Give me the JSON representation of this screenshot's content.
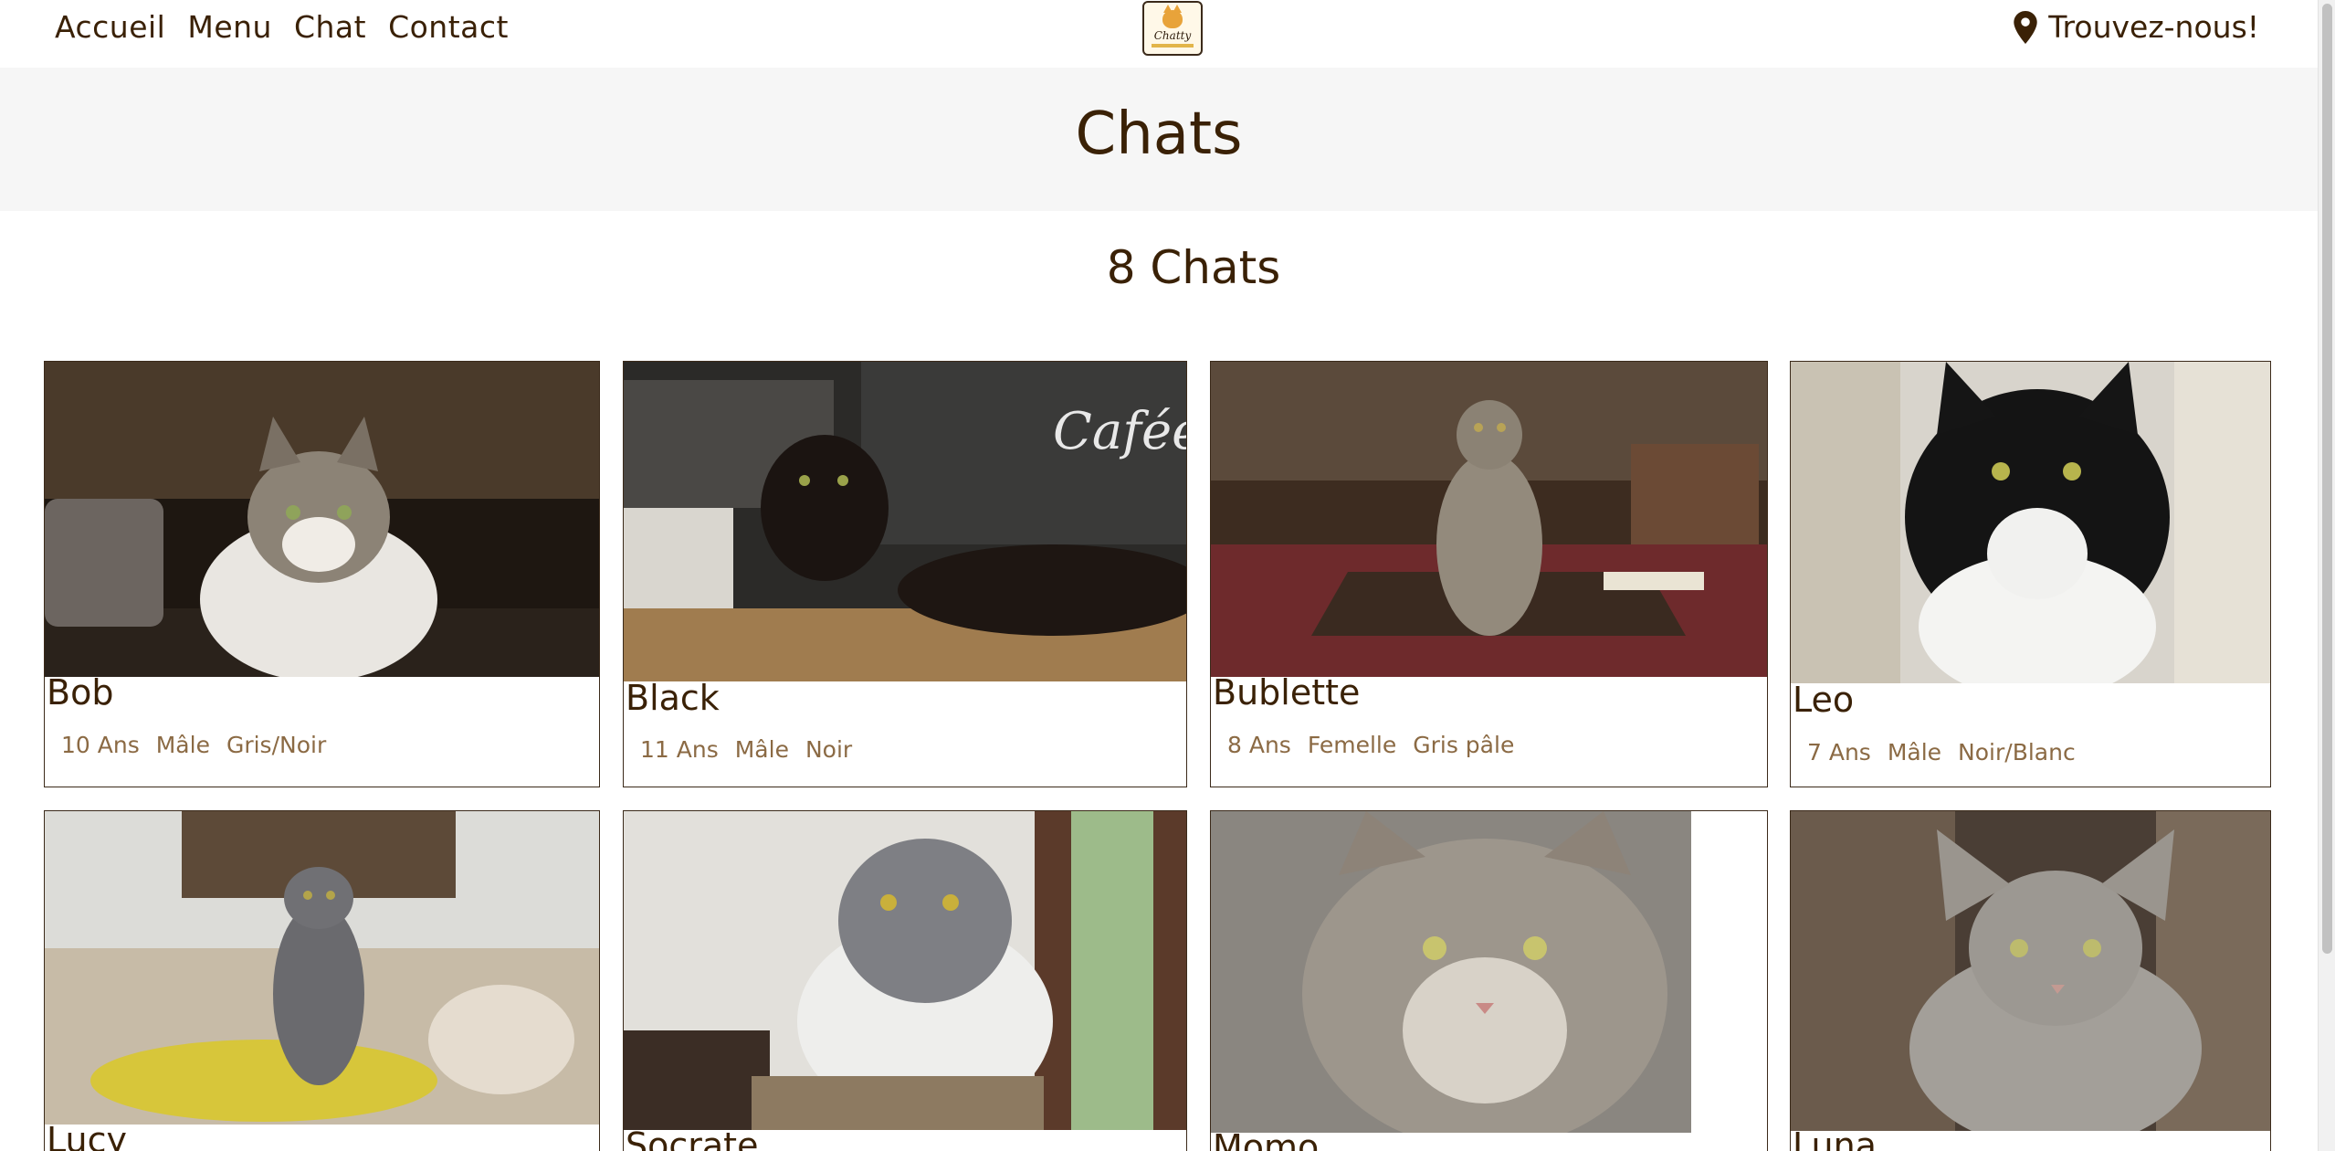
{
  "nav": {
    "items": [
      "Accueil",
      "Menu",
      "Chat",
      "Contact"
    ],
    "find_us": "Trouvez-nous!",
    "logo_text": "Chatty"
  },
  "header": {
    "title": "Chats"
  },
  "listing": {
    "count_label": "8 Chats",
    "cats": [
      {
        "name": "Bob",
        "age": "10 Ans",
        "sex": "Mâle",
        "color": "Gris/Noir"
      },
      {
        "name": "Black",
        "age": "11 Ans",
        "sex": "Mâle",
        "color": "Noir"
      },
      {
        "name": "Bublette",
        "age": "8 Ans",
        "sex": "Femelle",
        "color": "Gris pâle"
      },
      {
        "name": "Leo",
        "age": "7 Ans",
        "sex": "Mâle",
        "color": "Noir/Blanc"
      },
      {
        "name": "Lucy",
        "age": "",
        "sex": "",
        "color": ""
      },
      {
        "name": "Socrate",
        "age": "",
        "sex": "",
        "color": ""
      },
      {
        "name": "Momo",
        "age": "",
        "sex": "",
        "color": ""
      },
      {
        "name": "Luna",
        "age": "",
        "sex": "",
        "color": ""
      }
    ]
  },
  "colors": {
    "brand_brown": "#3a2106",
    "tag_brown": "#8b6a44",
    "band_gray": "#f6f6f6"
  }
}
